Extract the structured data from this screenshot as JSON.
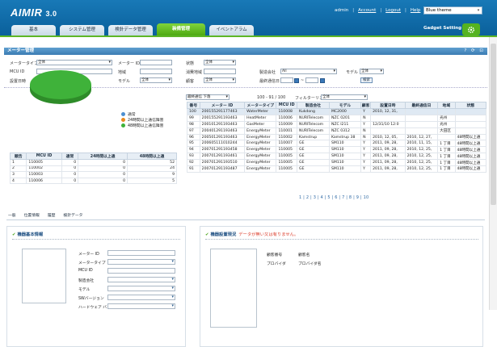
{
  "app": {
    "logo": "AIMIR",
    "version": "3.0"
  },
  "top_links": {
    "user": "admin",
    "account": "Account",
    "logout": "Logout",
    "help": "Help",
    "theme": "Blue theme"
  },
  "nav_tabs": [
    "基本",
    "システム管理",
    "検針データ管理",
    "装備管理",
    "イベントアラム"
  ],
  "gadget_setting": "Gadget Setting",
  "section_title": "メーター管理",
  "section_icons": "? ⟳ ⊡",
  "search": {
    "meter_type_label": "メータータイプ",
    "meter_type_value": "全体",
    "meter_id_label": "メーター ID",
    "status_label": "状態",
    "status_value": "全体",
    "mcu_id_label": "MCU ID",
    "region_label": "地域",
    "consumer_region_label": "消費地域",
    "mfr_label": "製造会社",
    "mfr_value": "All",
    "model_label": "モデル",
    "model_value": "全体",
    "install_date_label": "設置日時",
    "model2_label": "モデル",
    "model2_value": "全体",
    "customer_label": "顧客",
    "customer_value": "全体",
    "last_comm_label": "最終通信日",
    "search_button": "検索",
    "tilde": "~"
  },
  "chart_data": {
    "type": "pie",
    "categories": [
      "通常",
      "24時間以上通信障害",
      "48時間以上通信障害"
    ],
    "values": [
      100,
      0,
      0
    ],
    "colors": [
      "#3fb23a",
      "#e98a1f",
      "#d9342b"
    ]
  },
  "summary_table": {
    "headers": [
      "順告",
      "MCU ID",
      "通常",
      "24時間以上通",
      "48時間以上通"
    ],
    "rows": [
      [
        "1",
        "110005",
        "0",
        "0",
        "52"
      ],
      [
        "2",
        "110002",
        "0",
        "0",
        "24"
      ],
      [
        "3",
        "110003",
        "0",
        "0",
        "9"
      ],
      [
        "4",
        "110006",
        "0",
        "0",
        "5"
      ]
    ]
  },
  "list_controls": {
    "sort": "最終通信 下落",
    "count": "100 - 91 / 100",
    "filter_label": "フィルターリング",
    "filter_value": "全体"
  },
  "meter_table": {
    "headers": [
      "番号",
      "メーター ID",
      "メータータイプ",
      "MCU ID",
      "製造会社",
      "モデル",
      "顧客",
      "設置日時",
      "最終通信日",
      "地域",
      "状態"
    ],
    "rows": [
      [
        "100",
        "200155291177463",
        "WaterMeter",
        "110008",
        "Kukdong",
        "MC2000",
        "Y",
        "2010, 12, 31,",
        "",
        "",
        ""
      ],
      [
        "99",
        "200155291193463",
        "HeatMeter",
        "110006",
        "NURITelecom",
        "NZC 0201",
        "N",
        "",
        "",
        "光州",
        ""
      ],
      [
        "98",
        "200101291193463",
        "GasMeter",
        "110009",
        "NURITelecom",
        "NZC I211",
        "Y",
        "12/31/10 12:0",
        "",
        "光州",
        ""
      ],
      [
        "97",
        "200401291193463",
        "EnergyMeter",
        "110001",
        "NURITelecom",
        "NZC 0312",
        "N",
        "",
        "",
        "大田区",
        ""
      ],
      [
        "96",
        "200501291193463",
        "EnergyMeter",
        "110002",
        "Kamstrup",
        "Kamstrup 38",
        "N",
        "2010, 12, 05,",
        "2010, 12, 27,",
        "",
        "48時間以上通"
      ],
      [
        "95",
        "200605111010244",
        "EnergyMeter",
        "110007",
        "GE",
        "SM110",
        "Y",
        "2011, 09, 28,",
        "2010, 11, 15,",
        "1 丁目",
        "48時間以上通"
      ],
      [
        "94",
        "200701291193458",
        "EnergyMeter",
        "110005",
        "GE",
        "SM110",
        "Y",
        "2011, 09, 28,",
        "2010, 12, 25,",
        "1 丁目",
        "48時間以上通"
      ],
      [
        "93",
        "200701291193461",
        "EnergyMeter",
        "110005",
        "GE",
        "SM110",
        "Y",
        "2011, 09, 28,",
        "2010, 12, 25,",
        "1 丁目",
        "48時間以上通"
      ],
      [
        "92",
        "200701291193510",
        "EnergyMeter",
        "110005",
        "GE",
        "SM110",
        "Y",
        "2011, 09, 28,",
        "2010, 12, 25,",
        "1 丁目",
        "48時間以上通"
      ],
      [
        "91",
        "200701291193487",
        "EnergyMeter",
        "110005",
        "GE",
        "SM110",
        "Y",
        "2011, 09, 28,",
        "2010, 12, 25,",
        "1 丁目",
        "48時間以上通"
      ]
    ]
  },
  "pagination": "1 | 2 | 3 | 4 | 5 | 6 | 7 | 8 | 9 | 10",
  "bottom_tabs": [
    "一般",
    "位置情報",
    "履歴",
    "検針データ"
  ],
  "basic_info": {
    "title": "機器基本情報",
    "fields": [
      "メーター ID",
      "メータータイプ",
      "MCU ID",
      "製造会社",
      "モデル",
      "SWバージョン",
      "ハードウェア バ"
    ]
  },
  "install_status": {
    "title": "機器設置現況",
    "warning": "データが無い又は有りません。",
    "labels": [
      "顧客番号",
      "顧客名",
      "プロバイダ",
      "プロバイダ名"
    ]
  }
}
